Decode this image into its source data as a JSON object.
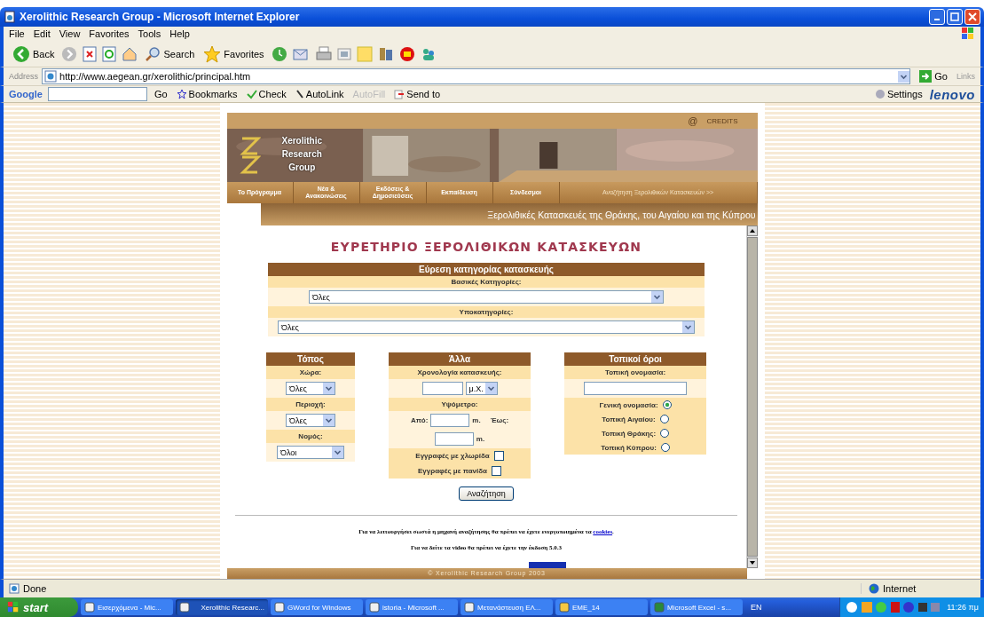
{
  "window": {
    "title": "Xerolithic Research Group - Microsoft Internet Explorer"
  },
  "menu": [
    "File",
    "Edit",
    "View",
    "Favorites",
    "Tools",
    "Help"
  ],
  "toolbar": {
    "back": "Back",
    "search": "Search",
    "favorites": "Favorites"
  },
  "address": {
    "label": "Address",
    "url": "http://www.aegean.gr/xerolithic/principal.htm",
    "go": "Go",
    "links": "Links"
  },
  "google_bar": {
    "logo": "Google",
    "go": "Go",
    "bookmarks": "Bookmarks",
    "check": "Check",
    "autolink": "AutoLink",
    "autofill": "AutoFill",
    "send_to": "Send to",
    "settings": "Settings",
    "brand": "lenovo"
  },
  "site": {
    "at": "@",
    "credits": "CREDITS",
    "logo_lines": [
      "Xerolithic",
      "Research",
      "Group"
    ],
    "nav": [
      {
        "label": "Το Πρόγραμμα"
      },
      {
        "label": "Νέα & Ανακοινώσεις"
      },
      {
        "label": "Εκδόσεις & Δημοσιεύσεις"
      },
      {
        "label": "Εκπαίδευση"
      },
      {
        "label": "Σύνδεσμοι"
      },
      {
        "label": "Αναζήτηση Ξερολιθικών Κατασκευών >>"
      }
    ],
    "tagline": "Ξερολιθικές Κατασκευές της Θράκης, του Αιγαίου και της Κύπρου",
    "heading": "ΕΥΡΕΤΗΡΙΟ ΞΕΡΟΛΙΘΙΚΩΝ ΚΑΤΑΣΚΕΥΩΝ",
    "category": {
      "title": "Εύρεση κατηγορίας κατασκευής",
      "main_label": "Βασικές Κατηγορίες:",
      "main_value": "Όλες",
      "sub_label": "Υποκατηγορίες:",
      "sub_value": "Όλες"
    },
    "place": {
      "title": "Τόπος",
      "fields": [
        {
          "label": "Χώρα:",
          "value": "Όλες"
        },
        {
          "label": "Περιοχή:",
          "value": "Όλες"
        },
        {
          "label": "Νομός:",
          "value": "Όλοι"
        }
      ]
    },
    "other": {
      "title": "Άλλα",
      "date_label": "Χρονολογία κατασκευής:",
      "era": "μ.Χ.",
      "altitude_label": "Υψόμετρο:",
      "from": "Από:",
      "to": "Έως:",
      "unit_from": "m.",
      "unit_to": "m.",
      "checks": [
        {
          "label": "Εγγραφές με χλωρίδα",
          "checked": false
        },
        {
          "label": "Εγγραφές με πανίδα",
          "checked": false
        }
      ]
    },
    "local": {
      "title": "Τοπικοί όροι",
      "name_label": "Τοπική ονομασία:",
      "options": [
        {
          "label": "Γενική ονομασία:",
          "selected": true
        },
        {
          "label": "Τοπική Αιγαίου:",
          "selected": false
        },
        {
          "label": "Τοπική Θράκης:",
          "selected": false
        },
        {
          "label": "Τοπική Κύπρου:",
          "selected": false
        }
      ]
    },
    "search_button": "Αναζήτηση",
    "note_cookies": "Για να λειτουργήσει σωστά η μηχανή αναζήτησης θα πρέπει να έχετε ενεργοποιημένα τα ",
    "cookies_link": "cookies",
    "cookies_end": ".",
    "note_video": "Για να δείτε τα video θα πρέπει να έχετε την έκδοση 5.0.3",
    "footer": "© Xerolithic Research Group 2003"
  },
  "status_bar": {
    "text": "Done",
    "zone": "Internet"
  },
  "taskbar": {
    "start": "start",
    "items": [
      {
        "label": "Εισερχόμενα - Mic...",
        "selected": false
      },
      {
        "label": "Xerolithic Researc...",
        "selected": true
      },
      {
        "label": "GWord for Windows",
        "selected": false
      },
      {
        "label": "istoria - Microsoft ...",
        "selected": false
      },
      {
        "label": "Μετανάστευση ΕΛ...",
        "selected": false
      },
      {
        "label": "EME_14",
        "selected": false
      },
      {
        "label": "Microsoft Excel - s...",
        "selected": false
      }
    ],
    "lang": "EN",
    "clock": "11:26 πμ"
  }
}
